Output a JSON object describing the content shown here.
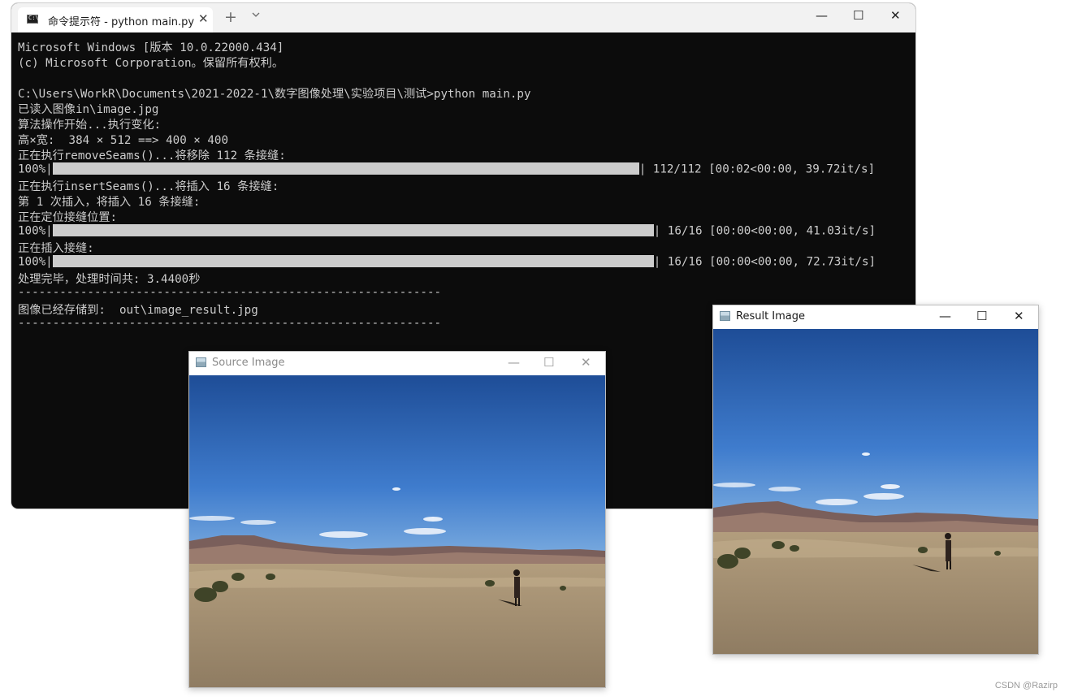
{
  "terminal": {
    "tab_title": "命令提示符 - python  main.py",
    "tab_close": "✕",
    "new_tab": "+",
    "minimize": "—",
    "maximize": "☐",
    "close": "✕",
    "lines": [
      "Microsoft Windows [版本 10.0.22000.434]",
      "(c) Microsoft Corporation。保留所有权利。",
      "",
      "C:\\Users\\WorkR\\Documents\\2021-2022-1\\数字图像处理\\实验项目\\测试>python main.py",
      "已读入图像in\\image.jpg",
      "算法操作开始...执行变化:",
      "高×宽:  384 × 512 ==> 400 × 400",
      "正在执行removeSeams()...将移除 112 条接缝:"
    ],
    "progress1": {
      "prefix": "100%|",
      "suffix": "| 112/112 [00:02<00:00, 39.72it/s]",
      "percent": 100
    },
    "lines_b": [
      "正在执行insertSeams()...将插入 16 条接缝:",
      "第 1 次插入，将插入 16 条接缝:",
      "正在定位接缝位置:"
    ],
    "progress2": {
      "prefix": "100%|",
      "suffix": "| 16/16 [00:00<00:00, 41.03it/s]",
      "percent": 100
    },
    "lines_c": [
      "正在插入接缝:"
    ],
    "progress3": {
      "prefix": "100%|",
      "suffix": "| 16/16 [00:00<00:00, 72.73it/s]",
      "percent": 100
    },
    "lines_d": [
      "处理完毕，处理时间共: 3.4400秒",
      "-------------------------------------------------------------",
      "图像已经存储到:  out\\image_result.jpg",
      "-------------------------------------------------------------"
    ]
  },
  "source_window": {
    "title": "Source Image",
    "minimize": "—",
    "maximize": "☐",
    "close": "✕",
    "title_color": "#8a8a8a"
  },
  "result_window": {
    "title": "Result Image",
    "minimize": "—",
    "maximize": "☐",
    "close": "✕",
    "title_color": "#1a1a1a"
  },
  "watermark": "CSDN @Razirp",
  "colors": {
    "terminal_bg": "#0c0c0c",
    "terminal_text": "#cccccc",
    "sky_top": "#1f4f99",
    "sky_bottom": "#6ea1dc",
    "sand": "#a38f73"
  }
}
